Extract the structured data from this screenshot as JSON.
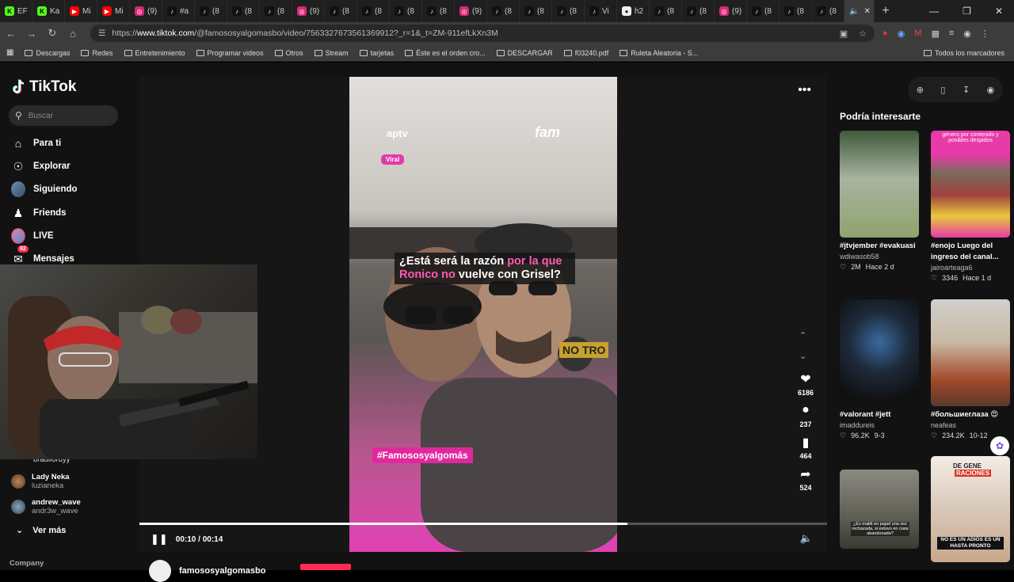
{
  "browser": {
    "tabs": [
      {
        "icon": "kick",
        "label": "EF",
        "color": "#53fc18"
      },
      {
        "icon": "kick",
        "label": "Ka",
        "color": "#53fc18"
      },
      {
        "icon": "youtube",
        "label": "Mi",
        "color": "#ff0000"
      },
      {
        "icon": "youtube",
        "label": "Mi",
        "color": "#ff0000"
      },
      {
        "icon": "instagram",
        "label": "(9)",
        "color": "#d62976"
      },
      {
        "icon": "tiktok",
        "label": "#a",
        "color": "#111111"
      },
      {
        "icon": "tiktok",
        "label": "(8",
        "color": "#111111"
      },
      {
        "icon": "tiktok",
        "label": "(8",
        "color": "#111111"
      },
      {
        "icon": "tiktok",
        "label": "(8",
        "color": "#111111"
      },
      {
        "icon": "instagram",
        "label": "(9)",
        "color": "#d62976"
      },
      {
        "icon": "tiktok",
        "label": "(8",
        "color": "#111111"
      },
      {
        "icon": "tiktok",
        "label": "(8",
        "color": "#111111"
      },
      {
        "icon": "tiktok",
        "label": "(8",
        "color": "#111111"
      },
      {
        "icon": "tiktok",
        "label": "(8",
        "color": "#111111"
      },
      {
        "icon": "instagram",
        "label": "(9)",
        "color": "#d62976"
      },
      {
        "icon": "tiktok",
        "label": "(8",
        "color": "#111111"
      },
      {
        "icon": "tiktok",
        "label": "(8",
        "color": "#111111"
      },
      {
        "icon": "tiktok",
        "label": "(8",
        "color": "#111111"
      },
      {
        "icon": "tiktok",
        "label": "Vi",
        "color": "#111111"
      },
      {
        "icon": "generic",
        "label": "h2",
        "color": "#eeeeee"
      },
      {
        "icon": "tiktok",
        "label": "(8",
        "color": "#111111"
      },
      {
        "icon": "tiktok",
        "label": "(8",
        "color": "#111111"
      },
      {
        "icon": "instagram",
        "label": "(9)",
        "color": "#d62976"
      },
      {
        "icon": "tiktok",
        "label": "(8",
        "color": "#111111"
      },
      {
        "icon": "tiktok",
        "label": "(8",
        "color": "#111111"
      },
      {
        "icon": "tiktok",
        "label": "(8",
        "color": "#111111"
      }
    ],
    "active_tab_icon": "speaker-icon",
    "url_prefix": "https://",
    "url_host": "www.tiktok.com",
    "url_path": "/@famososyalgomasbo/video/7563327673561369912?_r=1&_t=ZM-911efLkXn3M",
    "bookmarks": [
      "Descargas",
      "Redes",
      "Entretenimiento",
      "Programar videos",
      "Otros",
      "Stream",
      "tarjetas",
      "Éste es el orden cro...",
      "DESCARGAR",
      "f03240.pdf",
      "Ruleta Aleatoria - S..."
    ],
    "all_bookmarks": "Todos los marcadores"
  },
  "tiktok": {
    "brand": "TikTok",
    "search_placeholder": "Buscar",
    "nav": [
      {
        "label": "Para ti",
        "icon": "home-icon"
      },
      {
        "label": "Explorar",
        "icon": "compass-icon"
      },
      {
        "label": "Siguiendo",
        "icon": "following-avatar-icon"
      },
      {
        "label": "Friends",
        "icon": "friends-icon"
      },
      {
        "label": "LIVE",
        "icon": "live-avatar-icon"
      },
      {
        "label": "Mensajes",
        "icon": "messages-icon",
        "badge": "82"
      }
    ],
    "following": [
      {
        "name": "bradlloruyy",
        "handle": ""
      },
      {
        "name": "Lady Neka",
        "handle": "luzianeka"
      },
      {
        "name": "andrew_wave",
        "handle": "andr3w_wave"
      }
    ],
    "see_more": "Ver más",
    "company": "Company",
    "video": {
      "logo_left": "aptv",
      "logo_right": "fam",
      "tag": "Viral",
      "caption_part1": "¿Está será la razón ",
      "caption_pink1": "por la que",
      "caption_pink2": "Ronico no",
      "caption_part2": " vuelve con Grisel?",
      "hashtag": "#Famososyalgomás",
      "mic_text": "NO TRO",
      "time": "00:10 / 00:14",
      "progress_fraction": 0.71,
      "likes": "6186",
      "comments": "237",
      "saves": "464",
      "shares": "524",
      "author": "famososyalgomasbo"
    },
    "recommended_title": "Podría interesarte",
    "recommended": [
      {
        "title": "#jtvjember #evakuasi",
        "user": "wdiwasob58",
        "views": "2M",
        "age": "Hace 2 d"
      },
      {
        "title": "#enojo Luego del ingreso del canal...",
        "user": "jairoarteaga6",
        "views": "3346",
        "age": "Hace 1 d",
        "overlay": "género por contenido y posibles despidos"
      },
      {
        "title": "#valorant #jett",
        "user": "imaddureis",
        "views": "96.2K",
        "age": "9-3"
      },
      {
        "title": "#большиеглаза 😍",
        "user": "neafeas",
        "views": "234.2K",
        "age": "10-12"
      },
      {
        "overlay": "¿Es maldi en papel una vez rechazada, si estuvo en casa abandonada?"
      },
      {
        "overlay_top": "DE GENE",
        "overlay_top2": "RACIONES",
        "overlay": "NO ES UN ADIÓS ES UN HASTA PRONTO"
      }
    ]
  }
}
